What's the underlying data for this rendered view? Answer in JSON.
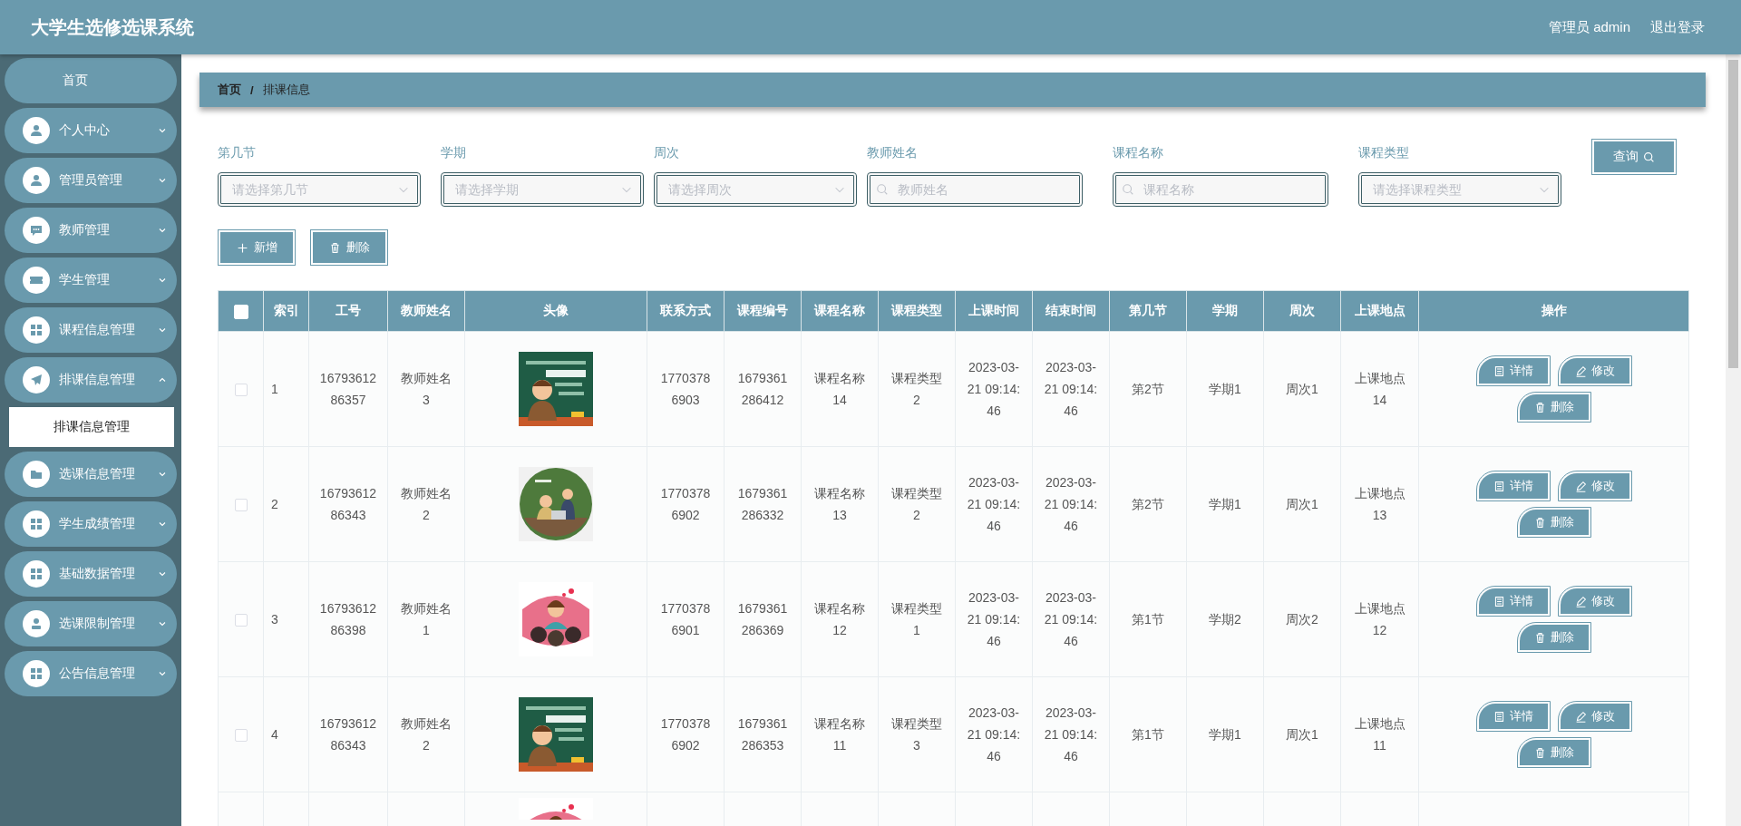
{
  "header": {
    "title": "大学生选修选课系统",
    "user": "管理员 admin",
    "logout": "退出登录"
  },
  "sidebar": {
    "items": [
      {
        "label": "首页",
        "kind": "link"
      },
      {
        "label": "个人中心",
        "kind": "group",
        "expanded": false
      },
      {
        "label": "管理员管理",
        "kind": "group",
        "expanded": false
      },
      {
        "label": "教师管理",
        "kind": "group",
        "expanded": false
      },
      {
        "label": "学生管理",
        "kind": "group",
        "expanded": false
      },
      {
        "label": "课程信息管理",
        "kind": "group",
        "expanded": false
      },
      {
        "label": "排课信息管理",
        "kind": "group",
        "expanded": true,
        "children": [
          {
            "label": "排课信息管理",
            "selected": true
          }
        ]
      },
      {
        "label": "选课信息管理",
        "kind": "group",
        "expanded": false
      },
      {
        "label": "学生成绩管理",
        "kind": "group",
        "expanded": false
      },
      {
        "label": "基础数据管理",
        "kind": "group",
        "expanded": false
      },
      {
        "label": "选课限制管理",
        "kind": "group",
        "expanded": false
      },
      {
        "label": "公告信息管理",
        "kind": "group",
        "expanded": false
      }
    ]
  },
  "breadcrumb": {
    "items": [
      "首页",
      "排课信息"
    ],
    "separator": "/"
  },
  "filters": [
    {
      "label": "第几节",
      "kind": "select",
      "placeholder": "请选择第几节"
    },
    {
      "label": "学期",
      "kind": "select",
      "placeholder": "请选择学期"
    },
    {
      "label": "周次",
      "kind": "select",
      "placeholder": "请选择周次"
    },
    {
      "label": "教师姓名",
      "kind": "search",
      "placeholder": "教师姓名"
    },
    {
      "label": "课程名称",
      "kind": "search",
      "placeholder": "课程名称"
    },
    {
      "label": "课程类型",
      "kind": "select",
      "placeholder": "请选择课程类型"
    }
  ],
  "query_button": "查询",
  "toolbar": [
    "新增",
    "删除"
  ],
  "table": {
    "header_checked": false,
    "columns": [
      "索引",
      "工号",
      "教师姓名",
      "头像",
      "联系方式",
      "课程编号",
      "课程名称",
      "课程类型",
      "上课时间",
      "结束时间",
      "第几节",
      "学期",
      "周次",
      "上课地点",
      "操作"
    ],
    "rows": [
      {
        "selected": false,
        "cells": [
          "1",
          "1679361286357",
          "教师姓名3",
          "",
          "17703786903",
          "1679361286412",
          "课程名称14",
          "课程类型2",
          "2023-03-21 09:14:46",
          "2023-03-21 09:14:46",
          "第2节",
          "学期1",
          "周次1",
          "上课地点14"
        ],
        "avatar": {
          "kind": "picture"
        },
        "actions": [
          "详情",
          "修改",
          "删除"
        ]
      },
      {
        "selected": false,
        "cells": [
          "2",
          "1679361286343",
          "教师姓名2",
          "",
          "17703786902",
          "1679361286332",
          "课程名称13",
          "课程类型2",
          "2023-03-21 09:14:46",
          "2023-03-21 09:14:46",
          "第2节",
          "学期1",
          "周次1",
          "上课地点13"
        ],
        "avatar": {
          "kind": "picture"
        },
        "actions": [
          "详情",
          "修改",
          "删除"
        ]
      },
      {
        "selected": false,
        "cells": [
          "3",
          "1679361286398",
          "教师姓名1",
          "",
          "17703786901",
          "1679361286369",
          "课程名称12",
          "课程类型1",
          "2023-03-21 09:14:46",
          "2023-03-21 09:14:46",
          "第1节",
          "学期2",
          "周次2",
          "上课地点12"
        ],
        "avatar": {
          "kind": "picture"
        },
        "actions": [
          "详情",
          "修改",
          "删除"
        ]
      },
      {
        "selected": false,
        "cells": [
          "4",
          "1679361286343",
          "教师姓名2",
          "",
          "17703786902",
          "1679361286353",
          "课程名称11",
          "课程类型3",
          "2023-03-21 09:14:46",
          "2023-03-21 09:14:46",
          "第1节",
          "学期1",
          "周次1",
          "上课地点11"
        ],
        "avatar": {
          "kind": "picture"
        },
        "actions": [
          "详情",
          "修改",
          "删除"
        ]
      }
    ]
  }
}
